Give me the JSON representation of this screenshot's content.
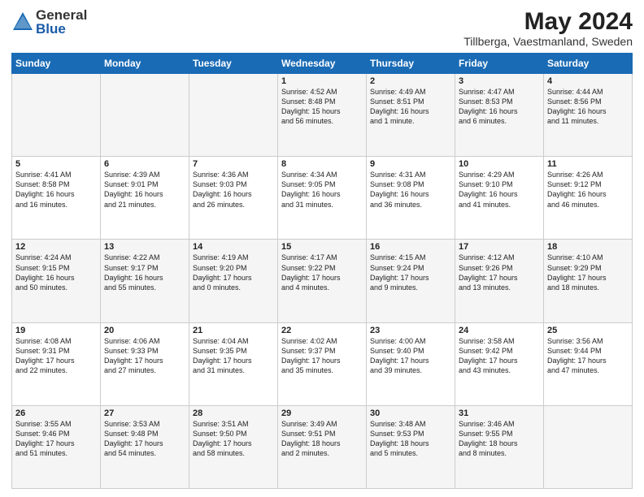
{
  "header": {
    "logo_general": "General",
    "logo_blue": "Blue",
    "month_year": "May 2024",
    "location": "Tillberga, Vaestmanland, Sweden"
  },
  "days_of_week": [
    "Sunday",
    "Monday",
    "Tuesday",
    "Wednesday",
    "Thursday",
    "Friday",
    "Saturday"
  ],
  "weeks": [
    [
      {
        "num": "",
        "info": ""
      },
      {
        "num": "",
        "info": ""
      },
      {
        "num": "",
        "info": ""
      },
      {
        "num": "1",
        "info": "Sunrise: 4:52 AM\nSunset: 8:48 PM\nDaylight: 15 hours\nand 56 minutes."
      },
      {
        "num": "2",
        "info": "Sunrise: 4:49 AM\nSunset: 8:51 PM\nDaylight: 16 hours\nand 1 minute."
      },
      {
        "num": "3",
        "info": "Sunrise: 4:47 AM\nSunset: 8:53 PM\nDaylight: 16 hours\nand 6 minutes."
      },
      {
        "num": "4",
        "info": "Sunrise: 4:44 AM\nSunset: 8:56 PM\nDaylight: 16 hours\nand 11 minutes."
      }
    ],
    [
      {
        "num": "5",
        "info": "Sunrise: 4:41 AM\nSunset: 8:58 PM\nDaylight: 16 hours\nand 16 minutes."
      },
      {
        "num": "6",
        "info": "Sunrise: 4:39 AM\nSunset: 9:01 PM\nDaylight: 16 hours\nand 21 minutes."
      },
      {
        "num": "7",
        "info": "Sunrise: 4:36 AM\nSunset: 9:03 PM\nDaylight: 16 hours\nand 26 minutes."
      },
      {
        "num": "8",
        "info": "Sunrise: 4:34 AM\nSunset: 9:05 PM\nDaylight: 16 hours\nand 31 minutes."
      },
      {
        "num": "9",
        "info": "Sunrise: 4:31 AM\nSunset: 9:08 PM\nDaylight: 16 hours\nand 36 minutes."
      },
      {
        "num": "10",
        "info": "Sunrise: 4:29 AM\nSunset: 9:10 PM\nDaylight: 16 hours\nand 41 minutes."
      },
      {
        "num": "11",
        "info": "Sunrise: 4:26 AM\nSunset: 9:12 PM\nDaylight: 16 hours\nand 46 minutes."
      }
    ],
    [
      {
        "num": "12",
        "info": "Sunrise: 4:24 AM\nSunset: 9:15 PM\nDaylight: 16 hours\nand 50 minutes."
      },
      {
        "num": "13",
        "info": "Sunrise: 4:22 AM\nSunset: 9:17 PM\nDaylight: 16 hours\nand 55 minutes."
      },
      {
        "num": "14",
        "info": "Sunrise: 4:19 AM\nSunset: 9:20 PM\nDaylight: 17 hours\nand 0 minutes."
      },
      {
        "num": "15",
        "info": "Sunrise: 4:17 AM\nSunset: 9:22 PM\nDaylight: 17 hours\nand 4 minutes."
      },
      {
        "num": "16",
        "info": "Sunrise: 4:15 AM\nSunset: 9:24 PM\nDaylight: 17 hours\nand 9 minutes."
      },
      {
        "num": "17",
        "info": "Sunrise: 4:12 AM\nSunset: 9:26 PM\nDaylight: 17 hours\nand 13 minutes."
      },
      {
        "num": "18",
        "info": "Sunrise: 4:10 AM\nSunset: 9:29 PM\nDaylight: 17 hours\nand 18 minutes."
      }
    ],
    [
      {
        "num": "19",
        "info": "Sunrise: 4:08 AM\nSunset: 9:31 PM\nDaylight: 17 hours\nand 22 minutes."
      },
      {
        "num": "20",
        "info": "Sunrise: 4:06 AM\nSunset: 9:33 PM\nDaylight: 17 hours\nand 27 minutes."
      },
      {
        "num": "21",
        "info": "Sunrise: 4:04 AM\nSunset: 9:35 PM\nDaylight: 17 hours\nand 31 minutes."
      },
      {
        "num": "22",
        "info": "Sunrise: 4:02 AM\nSunset: 9:37 PM\nDaylight: 17 hours\nand 35 minutes."
      },
      {
        "num": "23",
        "info": "Sunrise: 4:00 AM\nSunset: 9:40 PM\nDaylight: 17 hours\nand 39 minutes."
      },
      {
        "num": "24",
        "info": "Sunrise: 3:58 AM\nSunset: 9:42 PM\nDaylight: 17 hours\nand 43 minutes."
      },
      {
        "num": "25",
        "info": "Sunrise: 3:56 AM\nSunset: 9:44 PM\nDaylight: 17 hours\nand 47 minutes."
      }
    ],
    [
      {
        "num": "26",
        "info": "Sunrise: 3:55 AM\nSunset: 9:46 PM\nDaylight: 17 hours\nand 51 minutes."
      },
      {
        "num": "27",
        "info": "Sunrise: 3:53 AM\nSunset: 9:48 PM\nDaylight: 17 hours\nand 54 minutes."
      },
      {
        "num": "28",
        "info": "Sunrise: 3:51 AM\nSunset: 9:50 PM\nDaylight: 17 hours\nand 58 minutes."
      },
      {
        "num": "29",
        "info": "Sunrise: 3:49 AM\nSunset: 9:51 PM\nDaylight: 18 hours\nand 2 minutes."
      },
      {
        "num": "30",
        "info": "Sunrise: 3:48 AM\nSunset: 9:53 PM\nDaylight: 18 hours\nand 5 minutes."
      },
      {
        "num": "31",
        "info": "Sunrise: 3:46 AM\nSunset: 9:55 PM\nDaylight: 18 hours\nand 8 minutes."
      },
      {
        "num": "",
        "info": ""
      }
    ]
  ]
}
